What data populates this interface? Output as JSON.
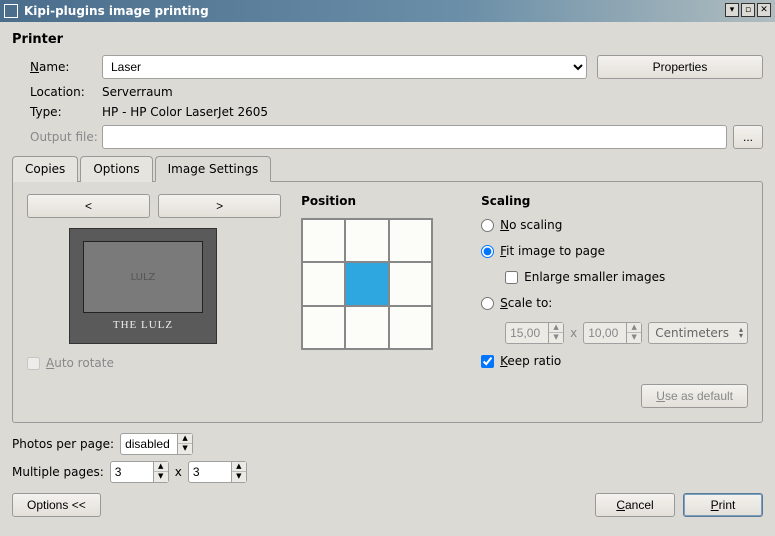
{
  "window": {
    "title": "Kipi-plugins image printing"
  },
  "printer_section": {
    "title": "Printer",
    "name_label": "Name:",
    "name_value": "Laser",
    "properties_btn": "Properties",
    "location_label": "Location:",
    "location_value": "Serverraum",
    "type_label": "Type:",
    "type_value": "HP - HP Color LaserJet 2605",
    "output_label": "Output file:",
    "output_btn": "..."
  },
  "tabs": {
    "copies": "Copies",
    "options": "Options",
    "image_settings": "Image Settings",
    "active": "image_settings"
  },
  "image_settings": {
    "prev_btn": "<",
    "next_btn": ">",
    "thumb_caption_top": "LULZ",
    "thumb_caption": "THE LULZ",
    "auto_rotate": "Auto rotate",
    "position_title": "Position",
    "position_selected": 4,
    "scaling": {
      "title": "Scaling",
      "no_scaling": "No scaling",
      "fit_to_page": "Fit image to page",
      "enlarge": "Enlarge smaller images",
      "scale_to": "Scale to:",
      "selected": "fit_to_page",
      "width": "15,00",
      "height": "10,00",
      "x_sep": "x",
      "unit": "Centimeters",
      "keep_ratio": "Keep ratio",
      "keep_ratio_checked": true,
      "use_default": "Use as default"
    }
  },
  "photos_per_page": {
    "label": "Photos per page:",
    "value": "disabled"
  },
  "multiple_pages": {
    "label": "Multiple pages:",
    "cols": "3",
    "x_sep": "x",
    "rows": "3"
  },
  "footer": {
    "options_btn": "Options <<",
    "cancel": "Cancel",
    "print": "Print"
  }
}
